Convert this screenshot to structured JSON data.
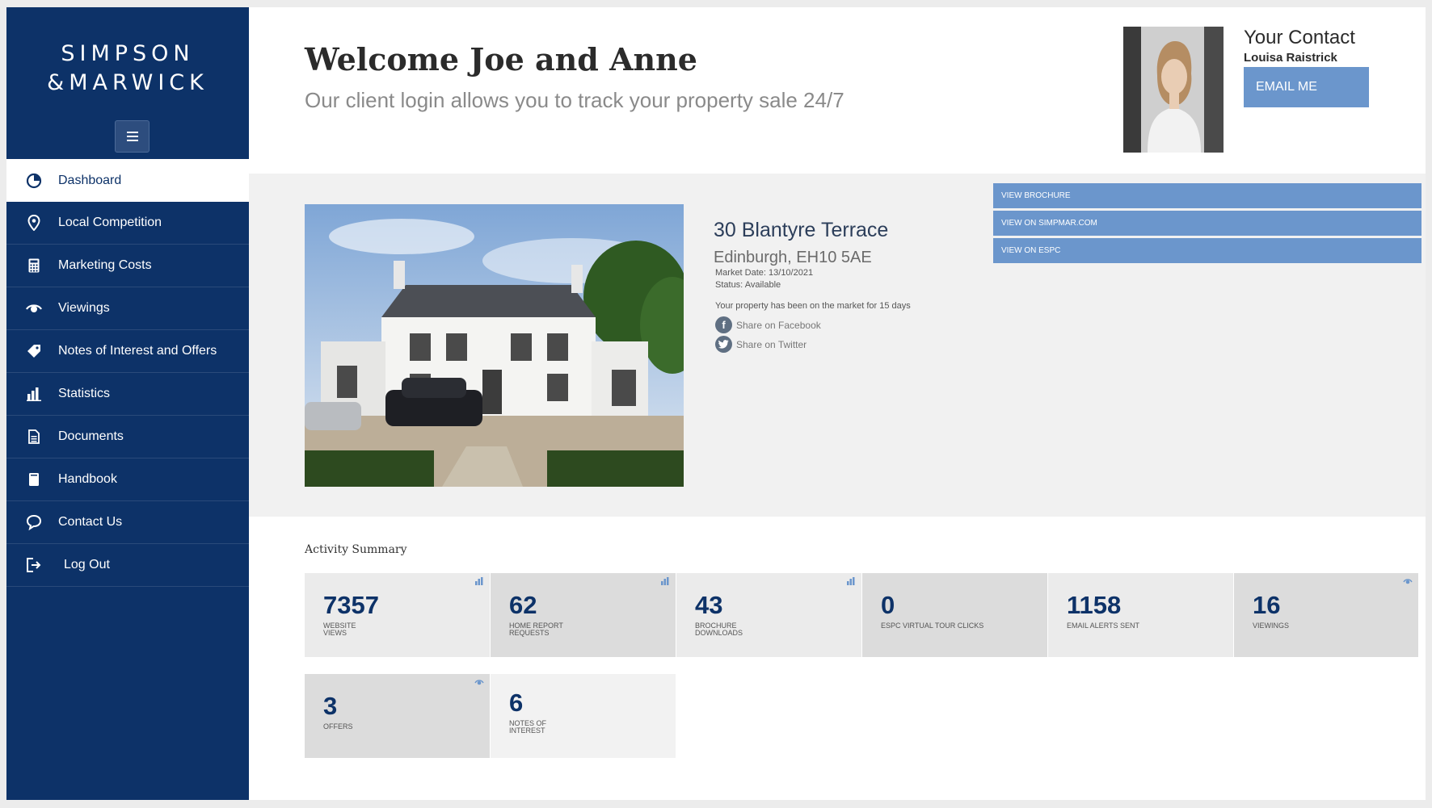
{
  "brand": {
    "line1": "SIMPSON",
    "line2": "&MARWICK"
  },
  "sidebar": {
    "items": [
      {
        "label": "Dashboard",
        "icon": "dashboard-icon",
        "active": true
      },
      {
        "label": "Local Competition",
        "icon": "map-pin-icon"
      },
      {
        "label": "Marketing Costs",
        "icon": "calculator-icon"
      },
      {
        "label": "Viewings",
        "icon": "eye-icon"
      },
      {
        "label": "Notes of Interest and Offers",
        "icon": "tag-icon"
      },
      {
        "label": "Statistics",
        "icon": "bar-chart-icon"
      },
      {
        "label": "Documents",
        "icon": "document-icon"
      },
      {
        "label": "Handbook",
        "icon": "book-icon"
      },
      {
        "label": "Contact Us",
        "icon": "speech-bubble-icon"
      },
      {
        "label": "Log Out",
        "icon": "logout-icon"
      }
    ]
  },
  "header": {
    "welcome": "Welcome Joe and Anne",
    "subtitle": "Our client login allows you to track your property sale 24/7"
  },
  "contact": {
    "title": "Your Contact",
    "name": "Louisa Raistrick",
    "email_label": "EMAIL ME"
  },
  "property": {
    "address": "30 Blantyre Terrace",
    "city": "Edinburgh, EH10 5AE",
    "market_date": "Market Date: 13/10/2021",
    "status": "Status: Available",
    "days_on_market": "Your property has been on the market for 15 days",
    "share_facebook": "Share on Facebook",
    "share_twitter": "Share on Twitter",
    "buttons": [
      "VIEW BROCHURE",
      "VIEW ON SIMPMAR.COM",
      "VIEW ON ESPC"
    ]
  },
  "activity": {
    "title": "Activity Summary",
    "stats": [
      {
        "value": "7357",
        "label": "WEBSITE VIEWS",
        "icon": "bar-chart-icon"
      },
      {
        "value": "62",
        "label": "HOME REPORT REQUESTS",
        "icon": "bar-chart-icon"
      },
      {
        "value": "43",
        "label": "BROCHURE DOWNLOADS",
        "icon": "bar-chart-icon"
      },
      {
        "value": "0",
        "label": "ESPC VIRTUAL TOUR CLICKS"
      },
      {
        "value": "1158",
        "label": "EMAIL ALERTS SENT"
      },
      {
        "value": "16",
        "label": "VIEWINGS",
        "icon": "eye-icon"
      },
      {
        "value": "3",
        "label": "OFFERS",
        "icon": "eye-icon"
      },
      {
        "value": "6",
        "label": "NOTES OF INTEREST"
      }
    ]
  },
  "colors": {
    "navy": "#0d3268",
    "accent_blue": "#6b96cc"
  }
}
